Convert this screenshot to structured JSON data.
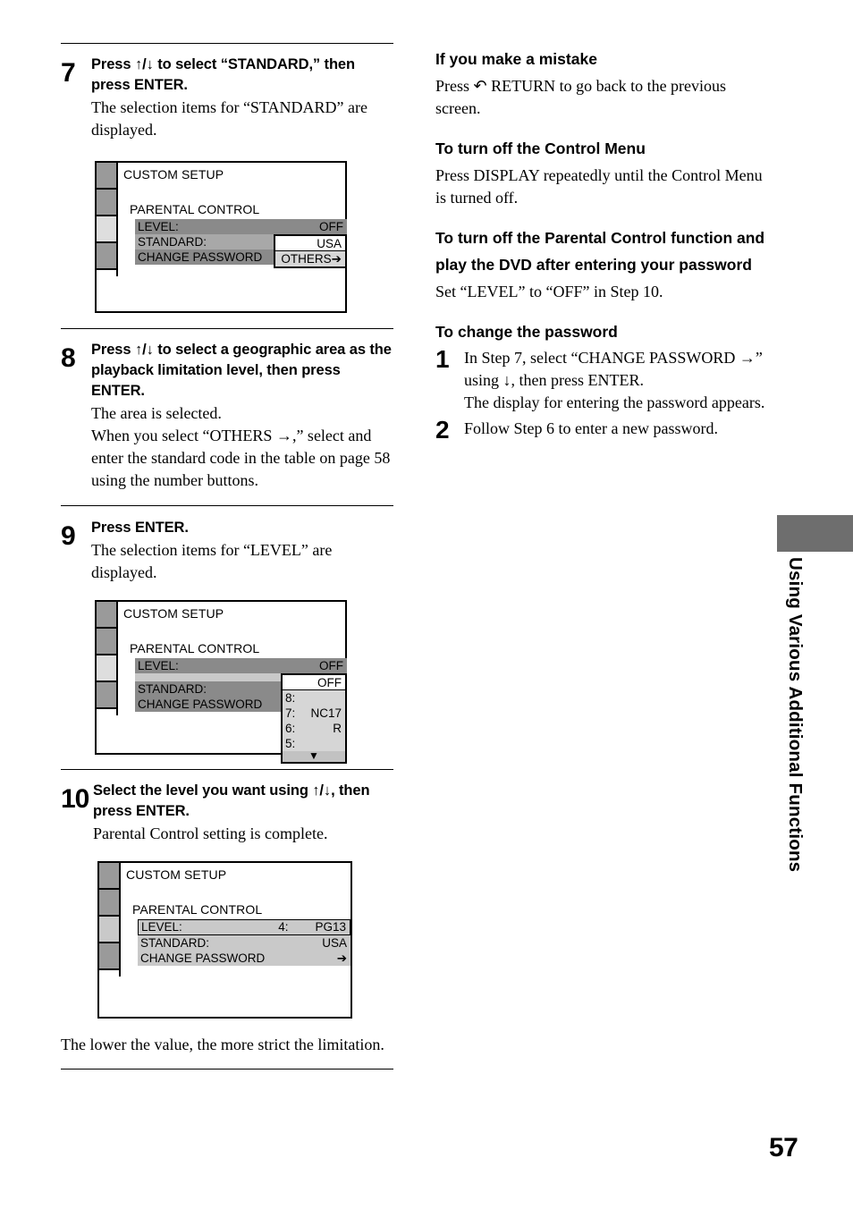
{
  "page": {
    "number": "57",
    "side_tab_label": "Using Various Additional Functions"
  },
  "left_column": {
    "steps": [
      {
        "number": "7",
        "heading": "Press ↑/↓ to select “STANDARD,” then press ENTER.",
        "description": "The selection items for “STANDARD” are displayed."
      },
      {
        "number": "8",
        "heading": "Press ↑/↓ to select a geographic area as the playback limitation level, then press ENTER.",
        "description": "The area is selected.\nWhen you select “OTHERS →,” select and enter the standard code in the table on page 58 using the number buttons."
      },
      {
        "number": "9",
        "heading": "Press ENTER.",
        "description": "The selection items for “LEVEL” are displayed."
      },
      {
        "number": "10",
        "heading": "Select the level you want using ↑/↓, then press ENTER.",
        "description": "Parental Control setting is complete."
      }
    ],
    "closing_note": "The lower the value, the more strict the limitation."
  },
  "screens": [
    {
      "id": "screen-standard",
      "title": "CUSTOM SETUP",
      "section": "PARENTAL CONTROL",
      "rows": [
        {
          "label": "LEVEL:",
          "value": "OFF",
          "style": "dark"
        },
        {
          "label": "STANDARD:",
          "value": "USA",
          "style": "mid"
        },
        {
          "label": "CHANGE PASSWORD",
          "value": "",
          "style": "dark"
        }
      ],
      "dropdown": {
        "selected": "USA",
        "items": [
          {
            "key": "",
            "value": "OTHERS➔"
          }
        ],
        "scroll_arrow": ""
      }
    },
    {
      "id": "screen-level",
      "title": "CUSTOM SETUP",
      "section": "PARENTAL CONTROL",
      "rows": [
        {
          "label": "LEVEL:",
          "value": "OFF",
          "style": "dark"
        },
        {
          "label": "STANDARD:",
          "value": "",
          "style": "dark"
        },
        {
          "label": "CHANGE PASSWORD",
          "value": "",
          "style": "dark"
        }
      ],
      "dropdown": {
        "selected": "OFF",
        "items": [
          {
            "key": "8:",
            "value": ""
          },
          {
            "key": "7:",
            "value": "NC17"
          },
          {
            "key": "6:",
            "value": "R"
          },
          {
            "key": "5:",
            "value": ""
          }
        ],
        "scroll_arrow": "▼"
      }
    },
    {
      "id": "screen-complete",
      "title": "CUSTOM SETUP",
      "section": "PARENTAL CONTROL",
      "rows": [
        {
          "label": "LEVEL:",
          "value": "4:        PG13",
          "style": "light-boxed"
        },
        {
          "label": "STANDARD:",
          "value": "USA",
          "style": "light"
        },
        {
          "label": "CHANGE PASSWORD",
          "value": "➔",
          "style": "light"
        }
      ],
      "dropdown": null
    }
  ],
  "right_column": {
    "sections": [
      {
        "heading": "If you make a mistake",
        "body": "Press ↶ RETURN to go back to the previous screen."
      },
      {
        "heading": "To turn off the Control Menu",
        "body": "Press DISPLAY repeatedly until the Control Menu is turned off."
      },
      {
        "heading": "To turn off the Parental Control function and play the DVD after entering your password",
        "body": "Set “LEVEL” to “OFF” in Step 10."
      }
    ],
    "change_password": {
      "heading": "To change the password",
      "steps": [
        {
          "number": "1",
          "body": "In Step 7, select “CHANGE PASSWORD →” using ↓, then press ENTER.\nThe display for entering the password appears."
        },
        {
          "number": "2",
          "body": "Follow Step 6 to enter a new password."
        }
      ]
    }
  },
  "colors": {
    "sidebar_dark": "#9a9a9a",
    "sidebar_light": "#dedede",
    "row_dark": "#8a8a8a",
    "row_mid": "#a8a8a8",
    "row_light": "#c9c9c9",
    "dropdown_list": "#d6d6d6",
    "side_tab": "#6e6e6e"
  }
}
